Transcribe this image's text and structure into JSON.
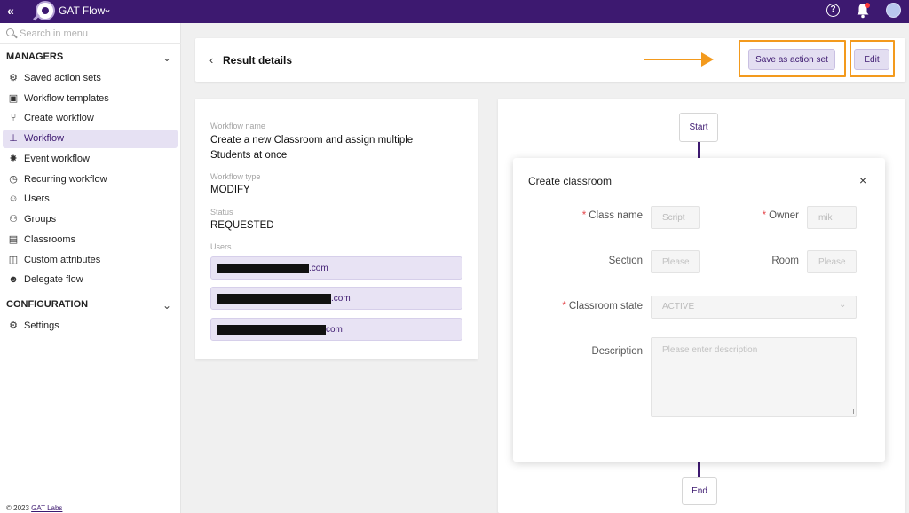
{
  "topbar": {
    "collapse_icon": "«",
    "app_name": "GAT Flow",
    "app_chevron": "⌄",
    "help_icon": "?",
    "colors": {
      "bar": "#3d1970",
      "accent": "#f39a1d"
    }
  },
  "sidebar": {
    "search_placeholder": "Search in menu",
    "managers_title": "MANAGERS",
    "managers_items": [
      {
        "label": "Saved action sets",
        "icon": "gear-list-icon",
        "glyph": "⚙"
      },
      {
        "label": "Workflow templates",
        "icon": "template-icon",
        "glyph": "▣"
      },
      {
        "label": "Create workflow",
        "icon": "branch-icon",
        "glyph": "⑂"
      },
      {
        "label": "Workflow",
        "icon": "hierarchy-icon",
        "glyph": "⊥"
      },
      {
        "label": "Event workflow",
        "icon": "event-icon",
        "glyph": "✸"
      },
      {
        "label": "Recurring workflow",
        "icon": "clock-icon",
        "glyph": "◷"
      },
      {
        "label": "Users",
        "icon": "user-search-icon",
        "glyph": "☺"
      },
      {
        "label": "Groups",
        "icon": "group-icon",
        "glyph": "⚇"
      },
      {
        "label": "Classrooms",
        "icon": "classroom-icon",
        "glyph": "▤"
      },
      {
        "label": "Custom attributes",
        "icon": "attributes-icon",
        "glyph": "◫"
      },
      {
        "label": "Delegate flow",
        "icon": "delegate-icon",
        "glyph": "☻"
      }
    ],
    "configuration_title": "CONFIGURATION",
    "configuration_items": [
      {
        "label": "Settings",
        "icon": "gear-icon",
        "glyph": "⚙"
      }
    ],
    "footer_text": "© 2023 ",
    "footer_link": "GAT Labs",
    "section_chevron": "⌄"
  },
  "header": {
    "back_icon": "‹",
    "title": "Result details",
    "save_action_set_label": "Save as action set",
    "edit_label": "Edit"
  },
  "details": {
    "workflow_name_label": "Workflow name",
    "workflow_name_line1": "Create a new Classroom and assign multiple",
    "workflow_name_line2": "Students at once",
    "workflow_type_label": "Workflow type",
    "workflow_type_value": "MODIFY",
    "status_label": "Status",
    "status_value": "REQUESTED",
    "users_label": "Users",
    "users": [
      {
        "domain": ".com"
      },
      {
        "domain": ".com"
      },
      {
        "domain": "com"
      }
    ]
  },
  "flow": {
    "start_label": "Start",
    "end_label": "End"
  },
  "modal": {
    "title": "Create classroom",
    "close_icon": "×",
    "class_name_label": "Class name",
    "class_name_value": "Script",
    "owner_label": "Owner",
    "owner_value": "mik",
    "section_label": "Section",
    "section_placeholder": "Please",
    "room_label": "Room",
    "room_placeholder": "Please",
    "classroom_state_label": "Classroom state",
    "classroom_state_value": "ACTIVE",
    "select_chevron": "⌄",
    "description_label": "Description",
    "description_placeholder": "Please enter description",
    "required_mark": "*"
  }
}
